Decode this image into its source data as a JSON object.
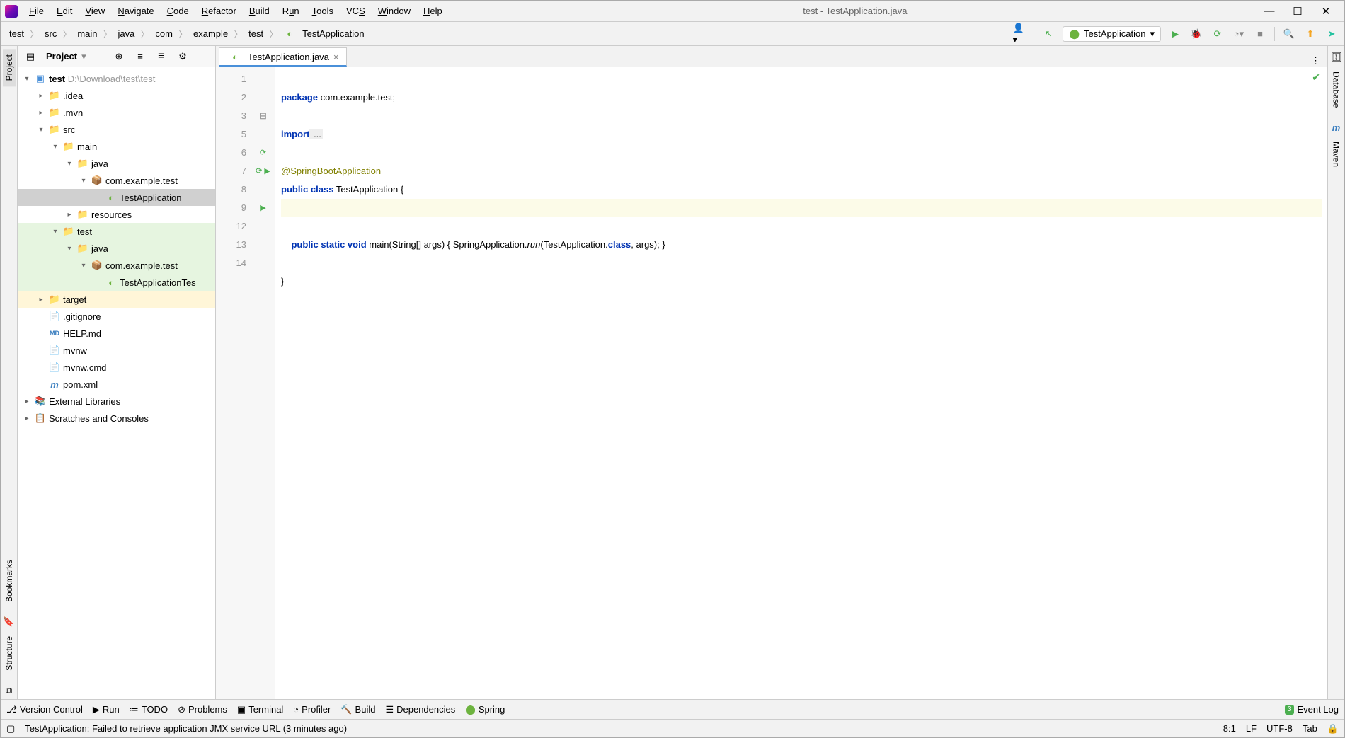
{
  "window_title": "test - TestApplication.java",
  "menu": [
    "File",
    "Edit",
    "View",
    "Navigate",
    "Code",
    "Refactor",
    "Build",
    "Run",
    "Tools",
    "VCS",
    "Window",
    "Help"
  ],
  "breadcrumbs": [
    "test",
    "src",
    "main",
    "java",
    "com",
    "example",
    "test",
    "TestApplication"
  ],
  "run_config_label": "TestApplication",
  "project_panel_title": "Project",
  "tree": {
    "root": {
      "name": "test",
      "location": "D:\\Download\\test\\test"
    },
    "idea": ".idea",
    "mvn": ".mvn",
    "src": "src",
    "main": "main",
    "main_java": "java",
    "pkg_main": "com.example.test",
    "main_class": "TestApplication",
    "resources": "resources",
    "test": "test",
    "test_java": "java",
    "pkg_test": "com.example.test",
    "test_class": "TestApplicationTes",
    "target": "target",
    "gitignore": ".gitignore",
    "help": "HELP.md",
    "mvnw": "mvnw",
    "mvnwcmd": "mvnw.cmd",
    "pom": "pom.xml",
    "ext_lib": "External Libraries",
    "scratches": "Scratches and Consoles"
  },
  "tab_label": "TestApplication.java",
  "left_tabs": [
    "Project",
    "Bookmarks",
    "Structure"
  ],
  "right_tabs": [
    "Database",
    "Maven"
  ],
  "code_lines": {
    "l1_package": "package",
    "l1_rest": " com.example.test;",
    "l3_import": "import",
    "l3_rest": " ...",
    "l6": "@SpringBootApplication",
    "l7_pub": "public",
    "l7_cls": " class",
    "l7_rest": " TestApplication {",
    "l9_pub": "public",
    "l9_static": " static",
    "l9_void": " void",
    "l9_main": " main",
    "l9_args": "(String[] args) { SpringApplication.",
    "l9_run": "run",
    "l9_pre": "(TestApplication.",
    "l9_class": "class",
    "l9_end": ", args); }",
    "l13": "}"
  },
  "line_numbers": [
    1,
    2,
    3,
    5,
    6,
    7,
    8,
    9,
    12,
    13,
    14
  ],
  "bottom_tools": [
    "Version Control",
    "Run",
    "TODO",
    "Problems",
    "Terminal",
    "Profiler",
    "Build",
    "Dependencies",
    "Spring"
  ],
  "event_log": "Event Log",
  "event_badge": "3",
  "status_msg": "TestApplication: Failed to retrieve application JMX service URL (3 minutes ago)",
  "status_right": {
    "pos": "8:1",
    "lf": "LF",
    "enc": "UTF-8",
    "tab": "Tab"
  }
}
